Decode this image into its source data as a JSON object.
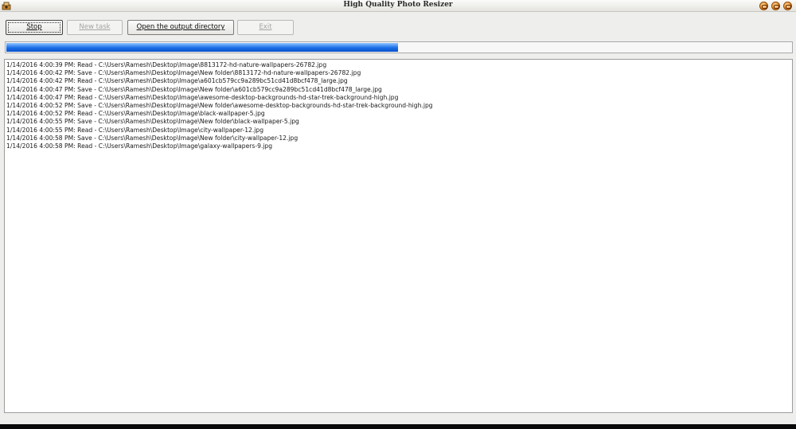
{
  "window": {
    "title": "High Quality Photo Resizer",
    "accent_color": "#1a6ee8"
  },
  "toolbar": {
    "stop_label": "Stop",
    "new_task_label": "New task",
    "open_output_label": "Open the output directory",
    "exit_label": "Exit"
  },
  "progress": {
    "fraction": 0.499
  },
  "log": {
    "lines": [
      "1/14/2016 4:00:39 PM: Read - C:\\Users\\Ramesh\\Desktop\\Image\\8813172-hd-nature-wallpapers-26782.jpg",
      "1/14/2016 4:00:42 PM: Save - C:\\Users\\Ramesh\\Desktop\\Image\\New folder\\8813172-hd-nature-wallpapers-26782.jpg",
      "1/14/2016 4:00:42 PM: Read - C:\\Users\\Ramesh\\Desktop\\Image\\a601cb579cc9a289bc51cd41d8bcf478_large.jpg",
      "1/14/2016 4:00:47 PM: Save - C:\\Users\\Ramesh\\Desktop\\Image\\New folder\\a601cb579cc9a289bc51cd41d8bcf478_large.jpg",
      "1/14/2016 4:00:47 PM: Read - C:\\Users\\Ramesh\\Desktop\\Image\\awesome-desktop-backgrounds-hd-star-trek-background-high.jpg",
      "1/14/2016 4:00:52 PM: Save - C:\\Users\\Ramesh\\Desktop\\Image\\New folder\\awesome-desktop-backgrounds-hd-star-trek-background-high.jpg",
      "1/14/2016 4:00:52 PM: Read - C:\\Users\\Ramesh\\Desktop\\Image\\black-wallpaper-5.jpg",
      "1/14/2016 4:00:55 PM: Save - C:\\Users\\Ramesh\\Desktop\\Image\\New folder\\black-wallpaper-5.jpg",
      "1/14/2016 4:00:55 PM: Read - C:\\Users\\Ramesh\\Desktop\\Image\\city-wallpaper-12.jpg",
      "1/14/2016 4:00:58 PM: Save - C:\\Users\\Ramesh\\Desktop\\Image\\New folder\\city-wallpaper-12.jpg",
      "1/14/2016 4:00:58 PM: Read - C:\\Users\\Ramesh\\Desktop\\Image\\galaxy-wallpapers-9.jpg"
    ]
  }
}
